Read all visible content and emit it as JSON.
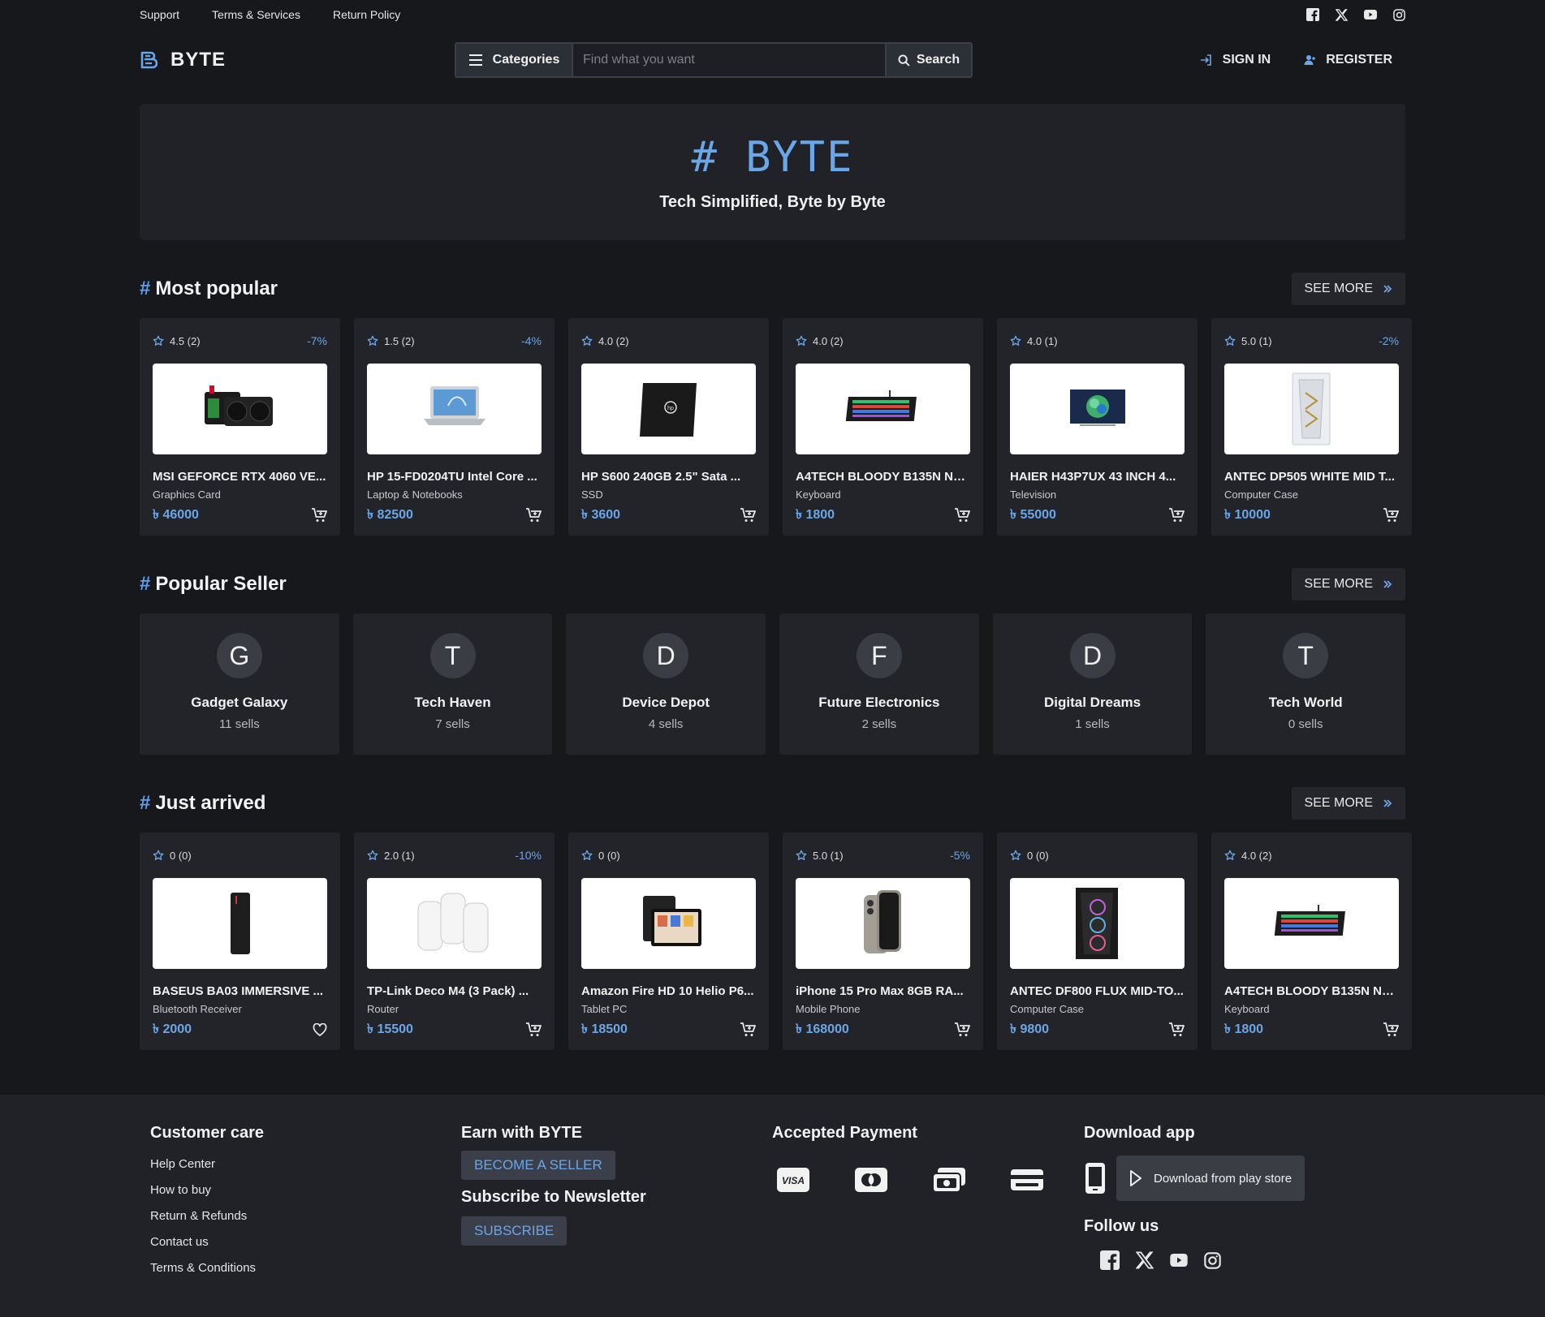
{
  "top_links": [
    "Support",
    "Terms & Services",
    "Return Policy"
  ],
  "brand": {
    "name": "BYTE",
    "accent": "#6aa6e8"
  },
  "search": {
    "categories_label": "Categories",
    "placeholder": "Find what you want",
    "button_label": "Search"
  },
  "auth": {
    "signin": "SIGN IN",
    "register": "REGISTER"
  },
  "hero": {
    "title": "# BYTE",
    "subtitle": "Tech Simplified, Byte by Byte"
  },
  "currency_symbol": "৳",
  "see_more_label": "SEE MORE",
  "most_popular": {
    "title": "Most popular",
    "items": [
      {
        "rating": "4.5 (2)",
        "discount": "-7%",
        "name": "MSI GEFORCE RTX 4060 VE...",
        "category": "Graphics Card",
        "price": "46000",
        "image": "gpu",
        "action": "cart"
      },
      {
        "rating": "1.5 (2)",
        "discount": "-4%",
        "name": "HP 15-FD0204TU Intel Core ...",
        "category": "Laptop & Notebooks",
        "price": "82500",
        "image": "laptop",
        "action": "cart"
      },
      {
        "rating": "4.0 (2)",
        "discount": "",
        "name": "HP S600 240GB 2.5\" Sata ...",
        "category": "SSD",
        "price": "3600",
        "image": "ssd",
        "action": "cart"
      },
      {
        "rating": "4.0 (2)",
        "discount": "",
        "name": "A4TECH BLOODY B135N NE...",
        "category": "Keyboard",
        "price": "1800",
        "image": "keyboard",
        "action": "cart"
      },
      {
        "rating": "4.0 (1)",
        "discount": "",
        "name": "HAIER H43P7UX 43 INCH 4...",
        "category": "Television",
        "price": "55000",
        "image": "tv",
        "action": "cart"
      },
      {
        "rating": "5.0 (1)",
        "discount": "-2%",
        "name": "ANTEC DP505 WHITE MID T...",
        "category": "Computer Case",
        "price": "10000",
        "image": "case-white",
        "action": "cart"
      }
    ]
  },
  "popular_seller": {
    "title": "Popular Seller",
    "items": [
      {
        "initial": "G",
        "name": "Gadget Galaxy",
        "sells": "11 sells"
      },
      {
        "initial": "T",
        "name": "Tech Haven",
        "sells": "7 sells"
      },
      {
        "initial": "D",
        "name": "Device Depot",
        "sells": "4 sells"
      },
      {
        "initial": "F",
        "name": "Future Electronics",
        "sells": "2 sells"
      },
      {
        "initial": "D",
        "name": "Digital Dreams",
        "sells": "1 sells"
      },
      {
        "initial": "T",
        "name": "Tech World",
        "sells": "0 sells"
      }
    ]
  },
  "just_arrived": {
    "title": "Just arrived",
    "items": [
      {
        "rating": "0 (0)",
        "discount": "",
        "name": "BASEUS BA03 IMMERSIVE ...",
        "category": "Bluetooth Receiver",
        "price": "2000",
        "image": "receiver",
        "action": "wishlist"
      },
      {
        "rating": "2.0 (1)",
        "discount": "-10%",
        "name": "TP-Link Deco M4 (3 Pack) ...",
        "category": "Router",
        "price": "15500",
        "image": "router",
        "action": "cart"
      },
      {
        "rating": "0 (0)",
        "discount": "",
        "name": "Amazon Fire HD 10 Helio P6...",
        "category": "Tablet PC",
        "price": "18500",
        "image": "tablet",
        "action": "cart"
      },
      {
        "rating": "5.0 (1)",
        "discount": "-5%",
        "name": "iPhone 15 Pro Max 8GB RA...",
        "category": "Mobile Phone",
        "price": "168000",
        "image": "phone",
        "action": "cart"
      },
      {
        "rating": "0 (0)",
        "discount": "",
        "name": "ANTEC DF800 FLUX MID-TO...",
        "category": "Computer Case",
        "price": "9800",
        "image": "case-black",
        "action": "cart"
      },
      {
        "rating": "4.0 (2)",
        "discount": "",
        "name": "A4TECH BLOODY B135N NE...",
        "category": "Keyboard",
        "price": "1800",
        "image": "keyboard",
        "action": "cart"
      }
    ]
  },
  "footer": {
    "customer_care": {
      "title": "Customer care",
      "links": [
        "Help Center",
        "How to buy",
        "Return & Refunds",
        "Contact us",
        "Terms & Conditions"
      ]
    },
    "earn": {
      "title": "Earn with BYTE",
      "button": "BECOME A SELLER"
    },
    "newsletter": {
      "title": "Subscribe to Newsletter",
      "button": "SUBSCRIBE"
    },
    "payment": {
      "title": "Accepted Payment",
      "icons": [
        "visa-icon",
        "mastercard-icon",
        "cash-icon",
        "card-icon"
      ],
      "visa_text": "VISA"
    },
    "download": {
      "title": "Download app",
      "play_label": "Download from play store"
    },
    "follow": {
      "title": "Follow us"
    }
  }
}
